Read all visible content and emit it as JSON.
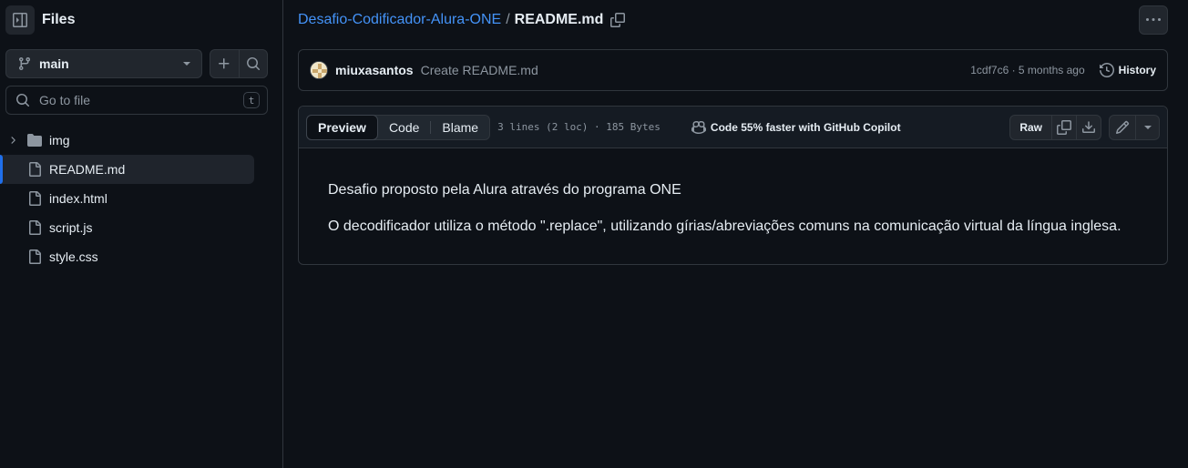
{
  "sidebar": {
    "title": "Files",
    "branch": "main",
    "goto_placeholder": "Go to file",
    "goto_shortcut": "t",
    "items": [
      {
        "label": "img",
        "type": "folder"
      },
      {
        "label": "README.md",
        "type": "file",
        "active": true
      },
      {
        "label": "index.html",
        "type": "file"
      },
      {
        "label": "script.js",
        "type": "file"
      },
      {
        "label": "style.css",
        "type": "file"
      }
    ]
  },
  "breadcrumb": {
    "repo": "Desafio-Codificador-Alura-ONE",
    "separator": "/",
    "file": "README.md"
  },
  "commit": {
    "author": "miuxasantos",
    "message": "Create README.md",
    "meta": "1cdf7c6 · 5 months ago",
    "history_label": "History"
  },
  "file_header": {
    "tabs": [
      "Preview",
      "Code",
      "Blame"
    ],
    "selected_tab": "Preview",
    "info": "3 lines (2 loc) · 185 Bytes",
    "copilot": "Code 55% faster with GitHub Copilot",
    "raw_label": "Raw"
  },
  "content": {
    "paragraphs": [
      "Desafio proposto pela Alura através do programa ONE",
      "O decodificador utiliza o método \".replace\", utilizando gírias/abreviações comuns na comunicação virtual da língua inglesa."
    ]
  },
  "colors": {
    "background": "#0d1117",
    "link": "#4493f8",
    "active_indicator": "#1f6feb",
    "muted": "#8d96a0",
    "border": "#30363d"
  },
  "icons": [
    "sidebar-collapse-icon",
    "git-branch-icon",
    "plus-icon",
    "search-icon",
    "chevron-right-icon",
    "folder-icon",
    "file-icon",
    "copy-icon",
    "kebab-horizontal-icon",
    "history-icon",
    "copilot-icon",
    "download-icon",
    "pencil-icon",
    "triangle-down-icon"
  ]
}
